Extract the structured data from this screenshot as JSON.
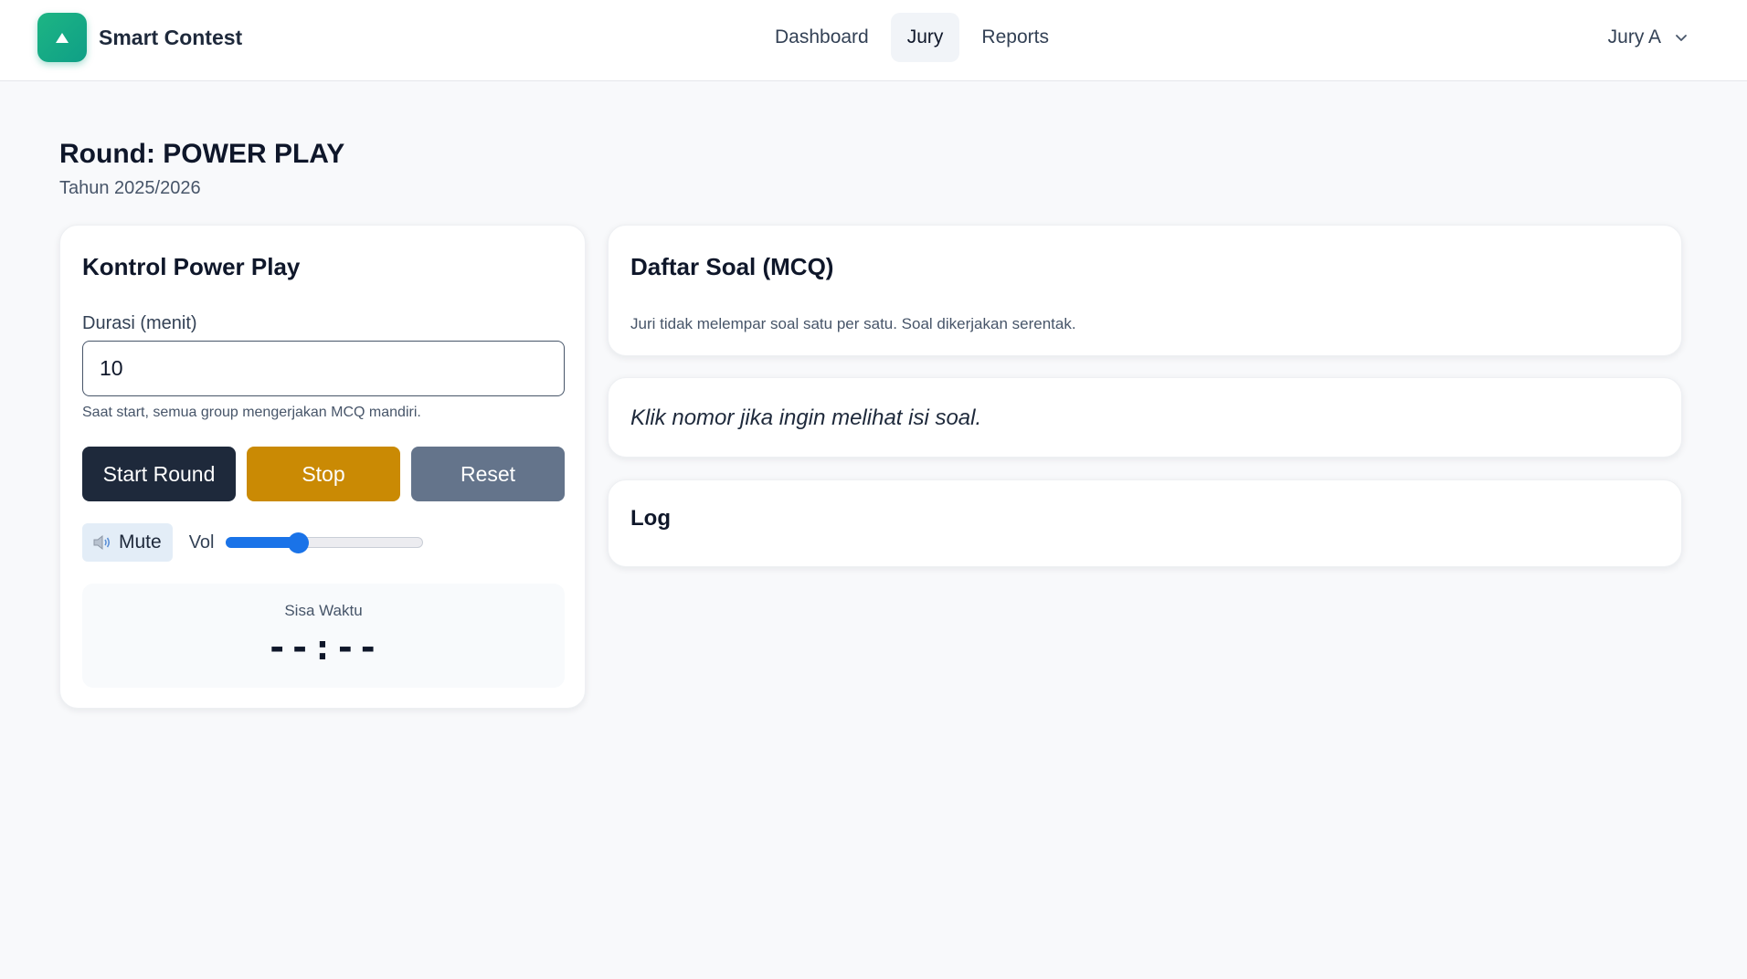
{
  "header": {
    "brand_name": "Smart Contest",
    "nav": [
      {
        "label": "Dashboard"
      },
      {
        "label": "Jury"
      },
      {
        "label": "Reports"
      }
    ],
    "active_nav": "Jury",
    "user_name": "Jury A"
  },
  "page": {
    "title": "Round: POWER PLAY",
    "subtitle": "Tahun 2025/2026"
  },
  "control": {
    "title": "Kontrol Power Play",
    "duration_label": "Durasi (menit)",
    "duration_value": "10",
    "hint": "Saat start, semua group mengerjakan MCQ mandiri.",
    "start_label": "Start Round",
    "stop_label": "Stop",
    "reset_label": "Reset",
    "mute_label": "Mute",
    "vol_label": "Vol",
    "volume_fraction": 0.37,
    "timer_label": "Sisa Waktu",
    "timer_value": "--:--"
  },
  "questions": {
    "title": "Daftar Soal (MCQ)",
    "description": "Juri tidak melempar soal satu per satu. Soal dikerjakan serentak.",
    "hint": "Klik nomor jika ingin melihat isi soal."
  },
  "log": {
    "title": "Log"
  },
  "colors": {
    "brand": "#10b981",
    "start": "#1e293b",
    "stop": "#ca8a04",
    "reset": "#64748b",
    "slider": "#1a73e8"
  },
  "icons": {
    "logo": "triangle-up-icon",
    "user_menu": "chevron-down-icon",
    "mute": "speaker-icon"
  }
}
